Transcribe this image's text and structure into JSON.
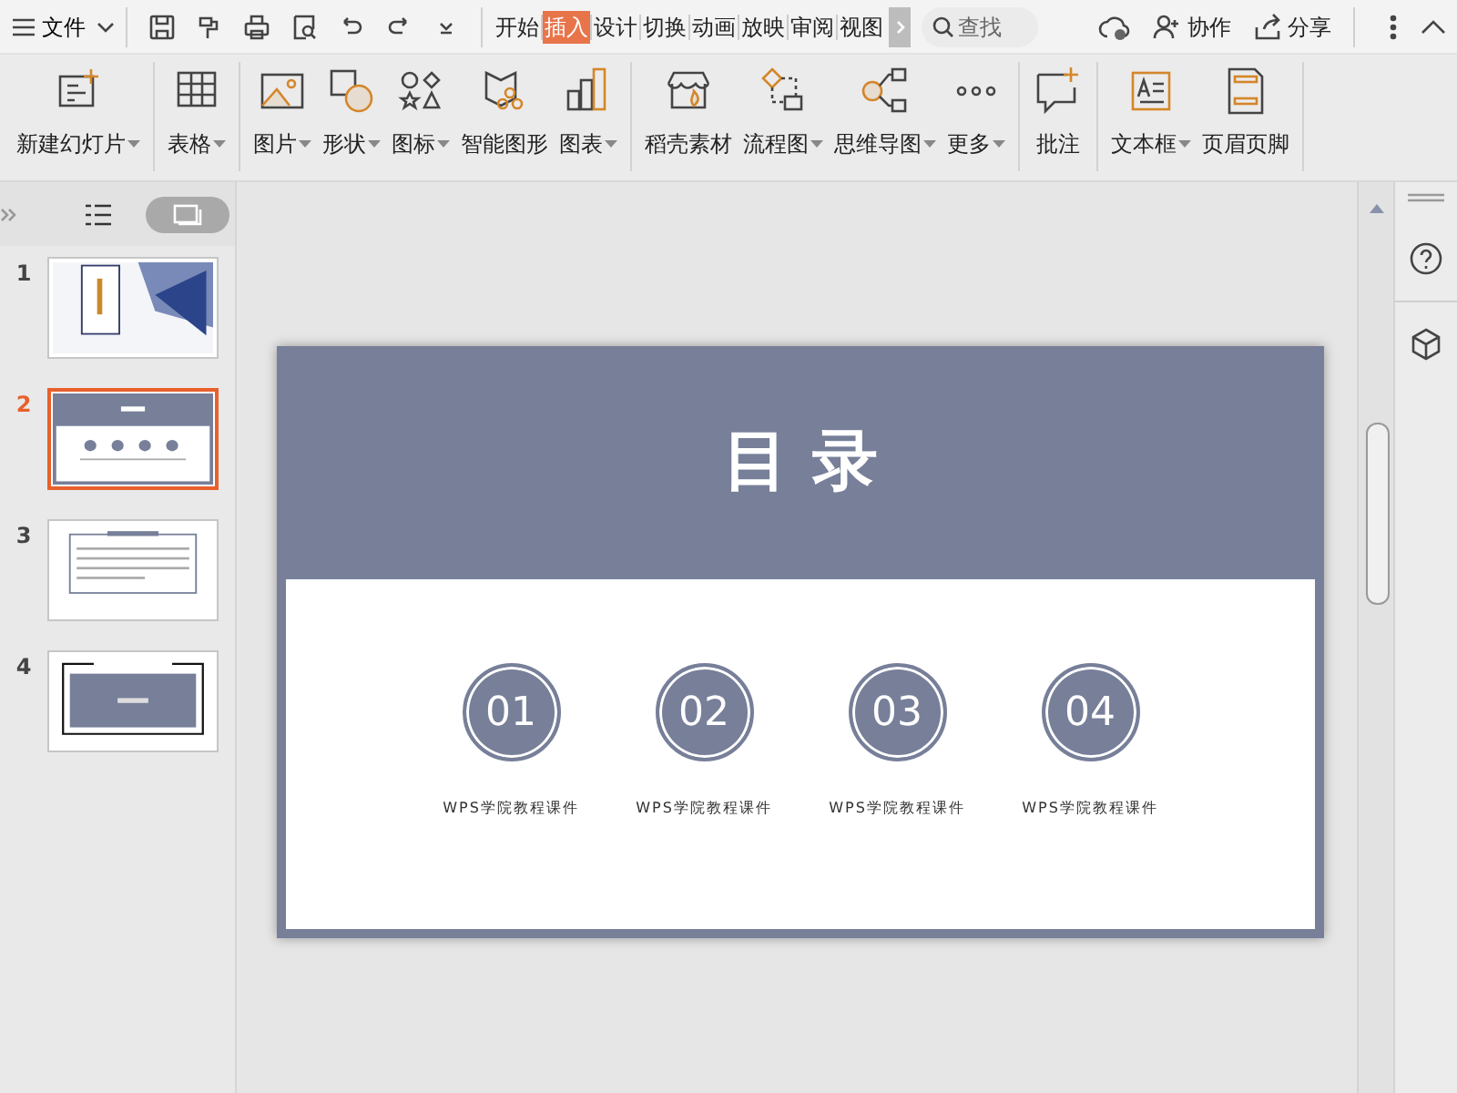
{
  "file_menu": {
    "label": "文件"
  },
  "tabs": [
    {
      "label": "开始",
      "selected": false
    },
    {
      "label": "插入",
      "selected": true
    },
    {
      "label": "设计",
      "selected": false
    },
    {
      "label": "切换",
      "selected": false
    },
    {
      "label": "动画",
      "selected": false
    },
    {
      "label": "放映",
      "selected": false
    },
    {
      "label": "审阅",
      "selected": false
    },
    {
      "label": "视图",
      "selected": false
    }
  ],
  "search": {
    "placeholder": "查找"
  },
  "actions": [
    {
      "label": "协作"
    },
    {
      "label": "分享"
    }
  ],
  "ribbon": {
    "groups": [
      [
        {
          "label": "新建幻灯片",
          "dropdown": true
        }
      ],
      [
        {
          "label": "表格",
          "dropdown": true
        }
      ],
      [
        {
          "label": "图片",
          "dropdown": true
        },
        {
          "label": "形状",
          "dropdown": true
        },
        {
          "label": "图标",
          "dropdown": true
        },
        {
          "label": "智能图形",
          "dropdown": false
        },
        {
          "label": "图表",
          "dropdown": true
        }
      ],
      [
        {
          "label": "稻壳素材",
          "dropdown": false
        },
        {
          "label": "流程图",
          "dropdown": true
        },
        {
          "label": "思维导图",
          "dropdown": true
        },
        {
          "label": "更多",
          "dropdown": true
        }
      ],
      [
        {
          "label": "批注",
          "dropdown": false
        }
      ],
      [
        {
          "label": "文本框",
          "dropdown": true
        },
        {
          "label": "页眉页脚",
          "dropdown": false
        }
      ]
    ]
  },
  "panel_views": [
    {
      "selected": false
    },
    {
      "selected": true
    }
  ],
  "slides": [
    {
      "number": "1",
      "selected": false
    },
    {
      "number": "2",
      "selected": true
    },
    {
      "number": "3",
      "selected": false
    },
    {
      "number": "4",
      "selected": false
    }
  ],
  "slide": {
    "title": "目 录",
    "items": [
      {
        "number": "01",
        "caption": "WPS学院教程课件"
      },
      {
        "number": "02",
        "caption": "WPS学院教程课件"
      },
      {
        "number": "03",
        "caption": "WPS学院教程课件"
      },
      {
        "number": "04",
        "caption": "WPS学院教程课件"
      }
    ]
  }
}
